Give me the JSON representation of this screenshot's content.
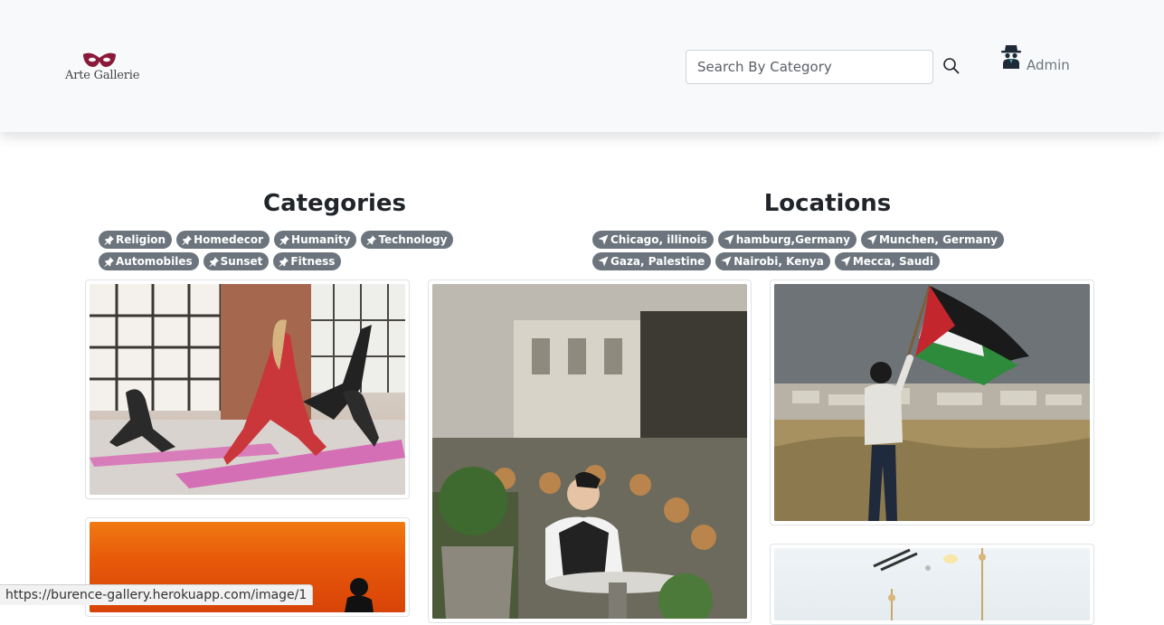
{
  "brand": {
    "name": "Arte Gallerie",
    "logo_color": "#8b1a3a"
  },
  "search": {
    "placeholder": "Search By Category",
    "value": ""
  },
  "user": {
    "label": "Admin",
    "icon": "spy-avatar-icon"
  },
  "categories": {
    "title": "Categories",
    "icon": "pushpin-icon",
    "items": [
      "Religion",
      "Homedecor",
      "Humanity",
      "Technology",
      "Automobiles",
      "Sunset",
      "Fitness"
    ]
  },
  "locations": {
    "title": "Locations",
    "icon": "location-arrow-icon",
    "items": [
      "Chicago, illinois",
      "hamburg,Germany",
      "Munchen, Germany",
      "Gaza, Palestine",
      "Nairobi, Kenya",
      "Mecca, Saudi"
    ]
  },
  "gallery": {
    "images": [
      "fitness-photo",
      "cafe-photo",
      "palestine-flag-photo",
      "sunset-photo",
      "interior-photo"
    ]
  },
  "status_bar": {
    "url": "https://burence-gallery.herokuapp.com/image/1"
  },
  "colors": {
    "badge_bg": "#6c757d",
    "navbar_bg": "#f8f9fa",
    "text": "#212529"
  }
}
